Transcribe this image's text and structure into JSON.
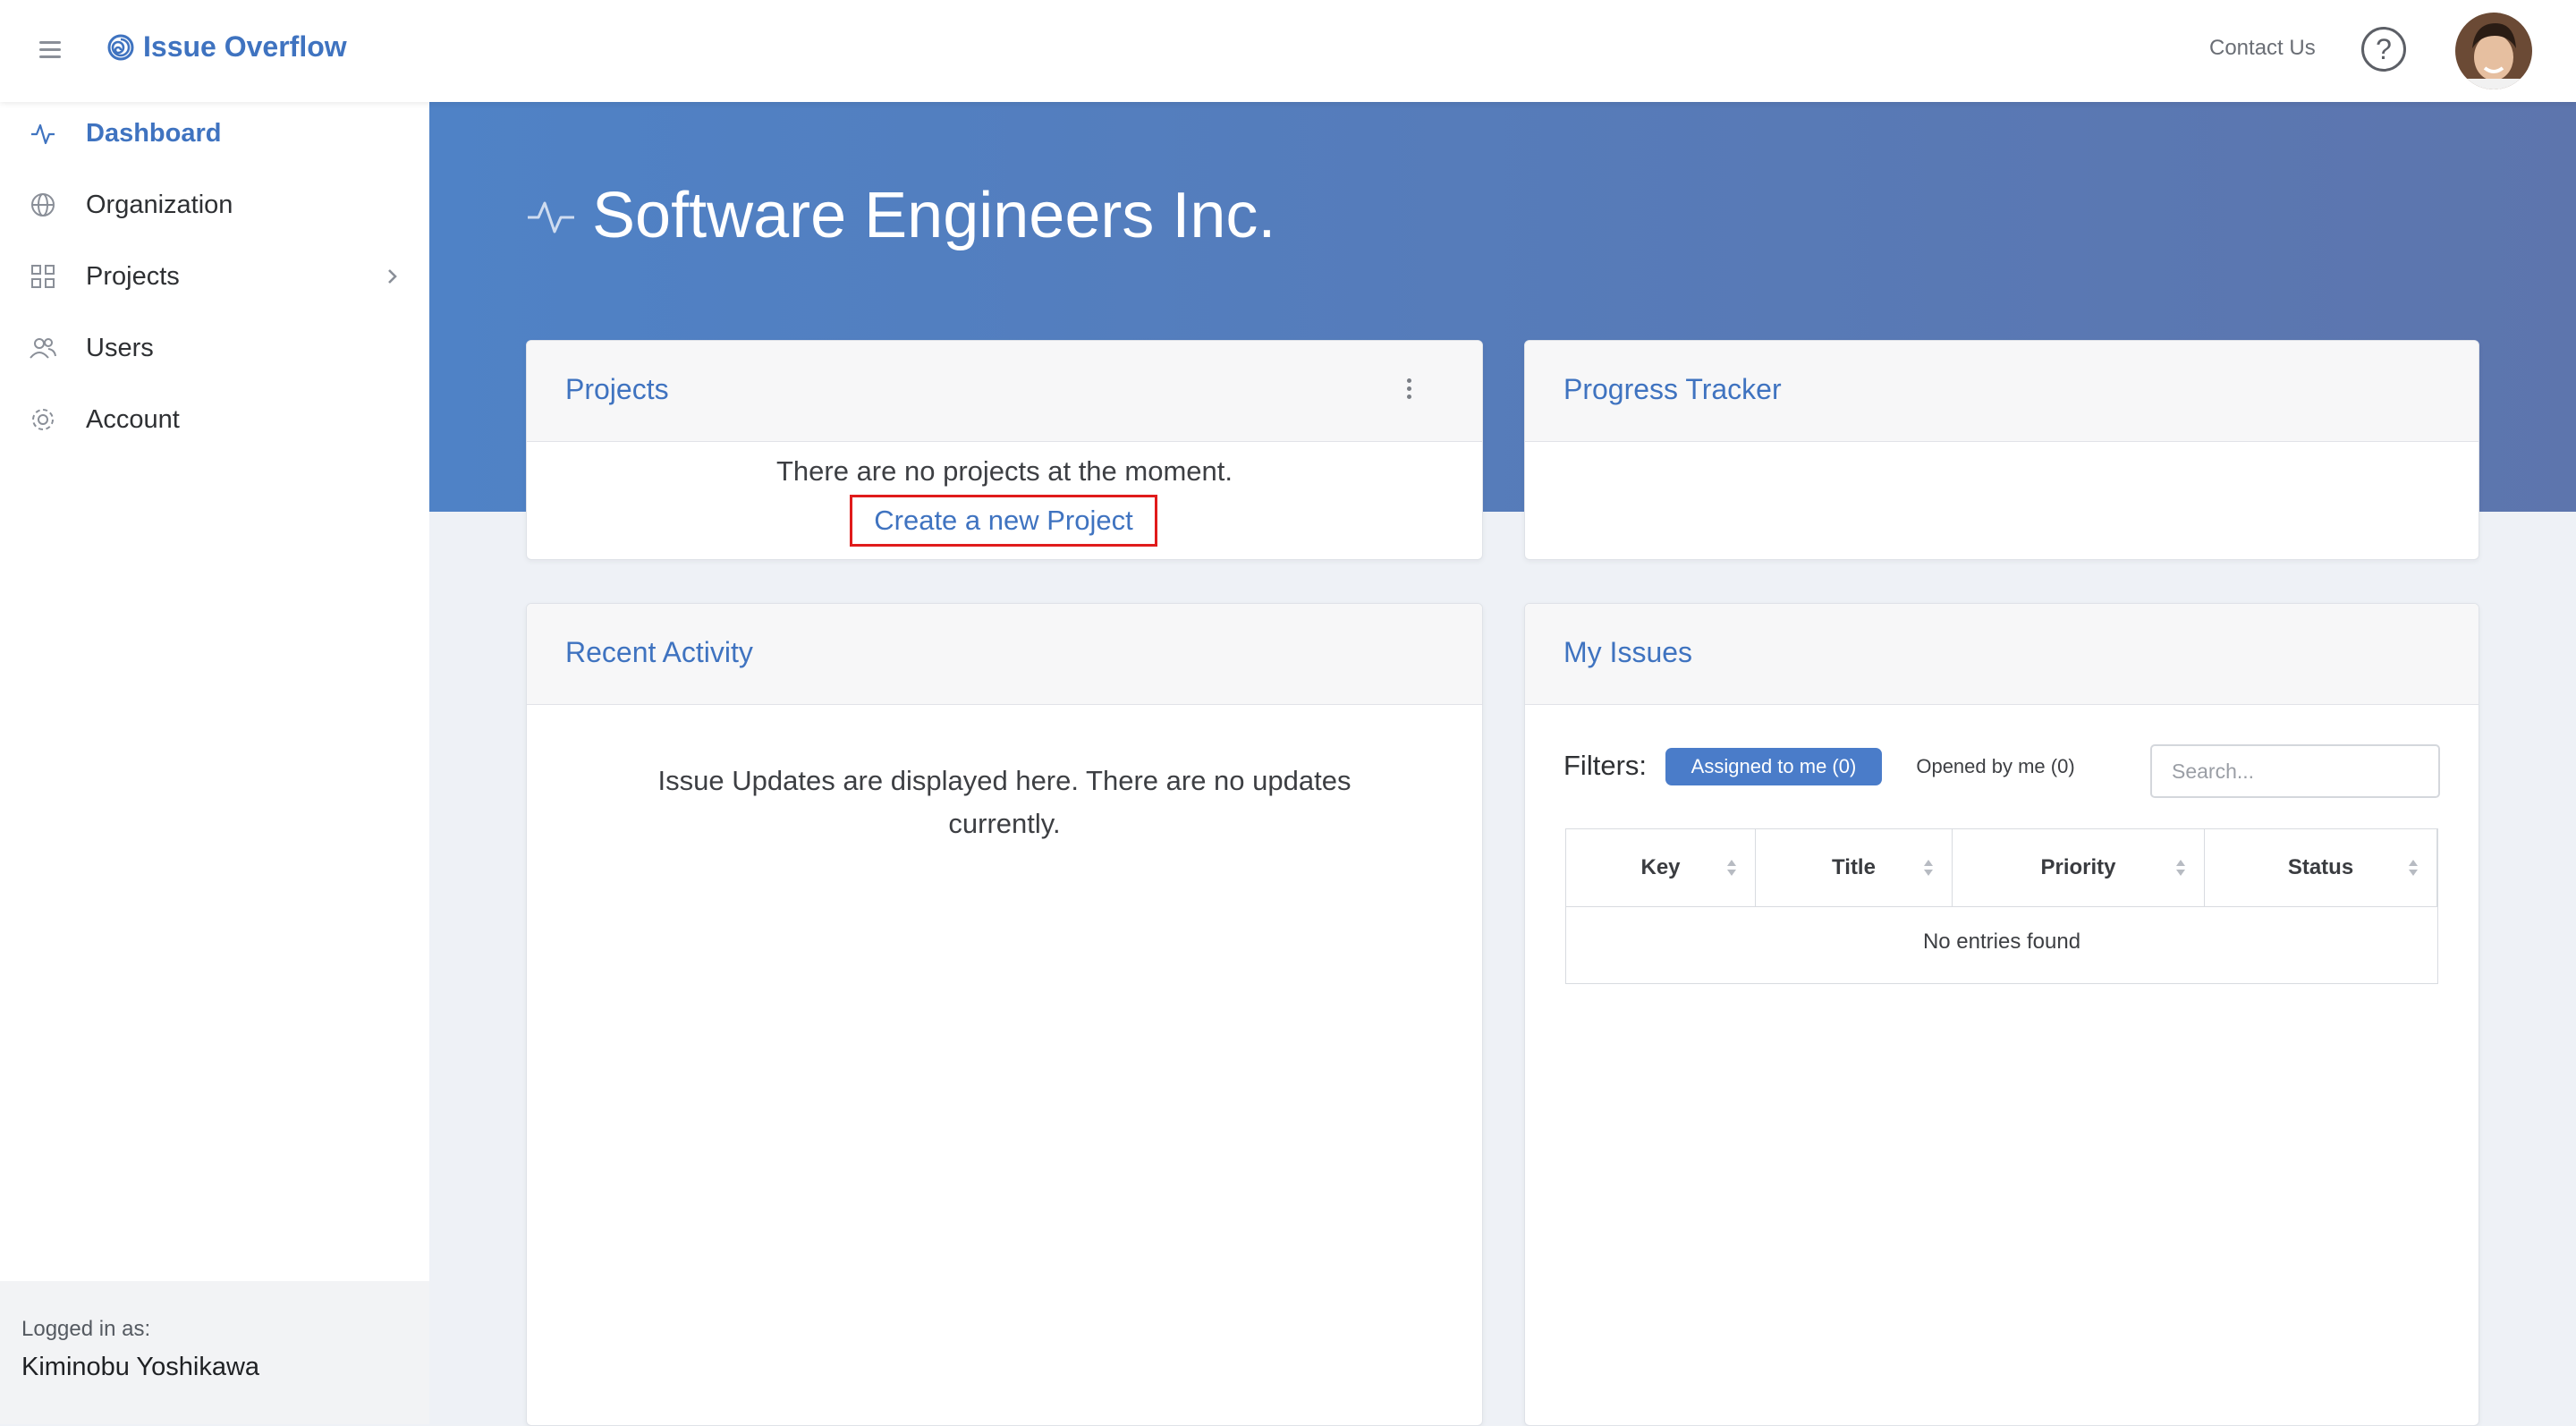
{
  "app": {
    "brand": "Issue Overflow"
  },
  "header": {
    "contact": "Contact Us",
    "help_symbol": "?"
  },
  "sidebar": {
    "items": [
      {
        "label": "Dashboard",
        "icon": "activity-icon",
        "active": true
      },
      {
        "label": "Organization",
        "icon": "globe-icon"
      },
      {
        "label": "Projects",
        "icon": "grid-icon",
        "has_submenu": true
      },
      {
        "label": "Users",
        "icon": "users-icon"
      },
      {
        "label": "Account",
        "icon": "gear-icon"
      }
    ],
    "logged_in_caption": "Logged in as:",
    "logged_in_user": "Kiminobu Yoshikawa"
  },
  "hero": {
    "title": "Software Engineers Inc."
  },
  "projects_card": {
    "title": "Projects",
    "empty_message": "There are no projects at the moment.",
    "create_link": "Create a new Project"
  },
  "progress_card": {
    "title": "Progress Tracker"
  },
  "activity_card": {
    "title": "Recent Activity",
    "message": "Issue Updates are displayed here. There are no updates currently."
  },
  "issues_card": {
    "title": "My Issues",
    "filters_label": "Filters:",
    "filter_assigned": "Assigned to me (0)",
    "filter_opened": "Opened by me (0)",
    "search_placeholder": "Search...",
    "columns": [
      "Key",
      "Title",
      "Priority",
      "Status"
    ],
    "empty": "No entries found"
  },
  "colors": {
    "accent": "#3f73c0",
    "hero_start": "#4f82c6",
    "hero_end": "#5d75ad",
    "highlight_border": "#e01b1b"
  }
}
